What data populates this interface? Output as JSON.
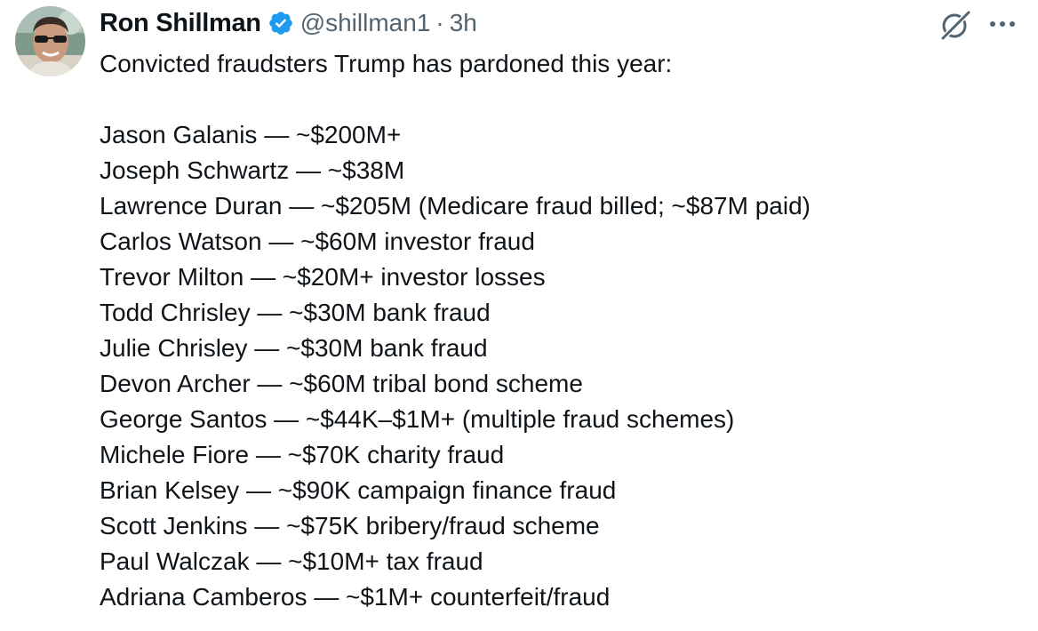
{
  "author": {
    "display_name": "Ron Shillman",
    "handle": "@shillman1",
    "separator": "·",
    "time": "3h",
    "avatar_icon": "profile-photo",
    "verified_icon": "verified-badge-icon",
    "verified_color": "#1d9bf0"
  },
  "actions": {
    "grok_icon": "grok-icon",
    "more_icon": "more-options-icon"
  },
  "tweet": {
    "intro": "Convicted fraudsters Trump has pardoned this year:",
    "lines": [
      "Jason Galanis — ~$200M+",
      "Joseph Schwartz — ~$38M",
      "Lawrence Duran — ~$205M (Medicare fraud billed; ~$87M paid)",
      "Carlos Watson — ~$60M investor fraud",
      "Trevor Milton — ~$20M+ investor losses",
      "Todd Chrisley — ~$30M bank fraud",
      "Julie Chrisley — ~$30M bank fraud",
      "Devon Archer — ~$60M tribal bond scheme",
      "George Santos — ~$44K–$1M+ (multiple fraud schemes)",
      "Michele Fiore — ~$70K charity fraud",
      "Brian Kelsey — ~$90K campaign finance fraud",
      "Scott Jenkins — ~$75K bribery/fraud scheme",
      "Paul Walczak — ~$10M+ tax fraud",
      "Adriana Camberos — ~$1M+ counterfeit/fraud"
    ]
  },
  "colors": {
    "text": "#0f1419",
    "secondary": "#536471",
    "accent": "#1d9bf0"
  }
}
